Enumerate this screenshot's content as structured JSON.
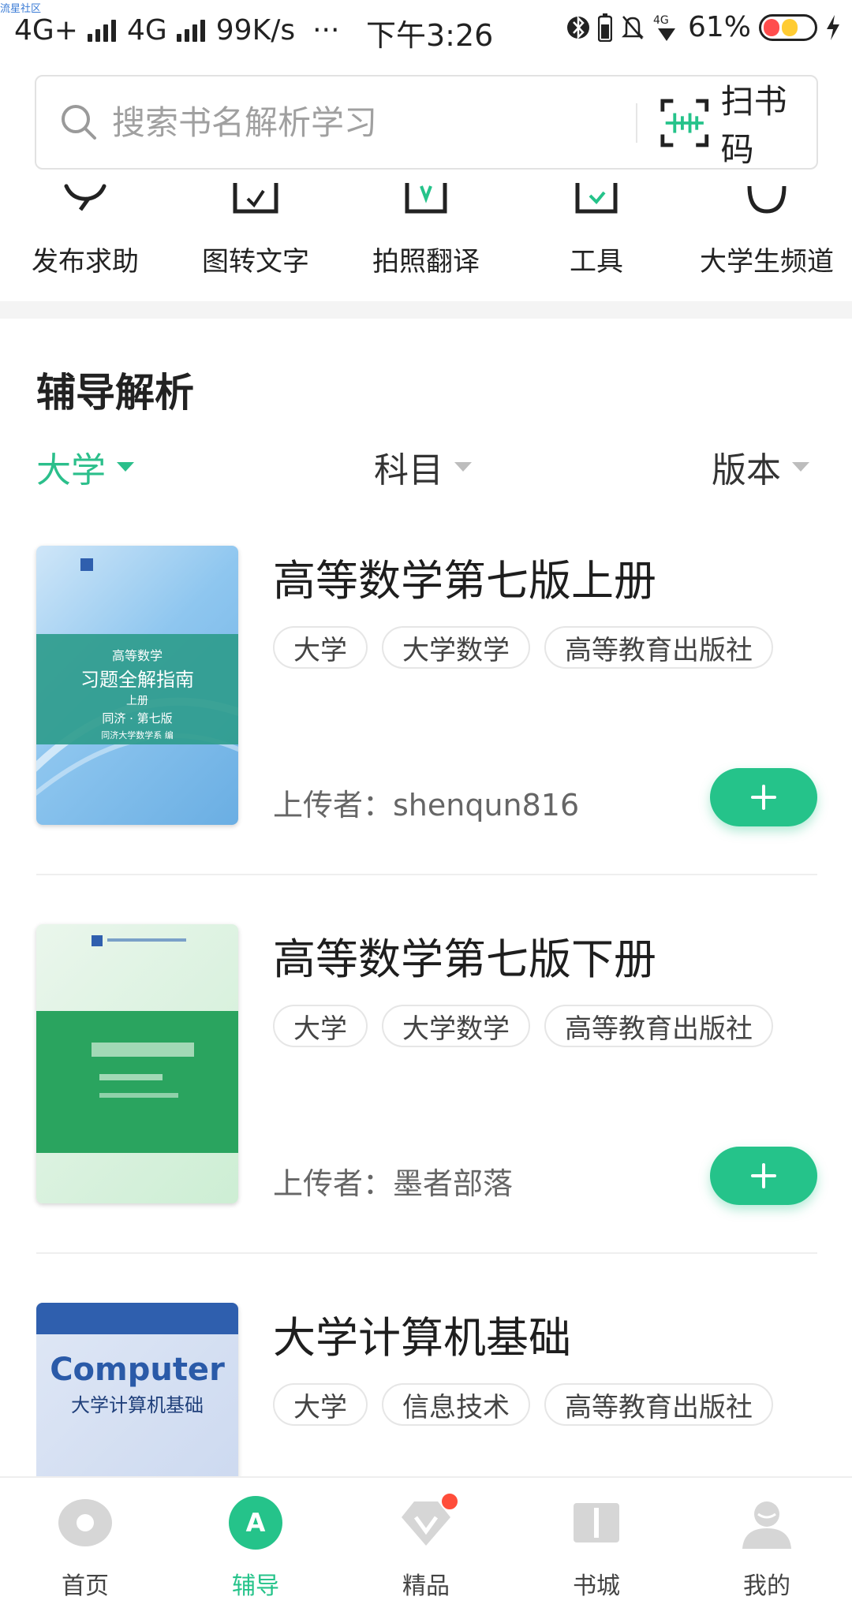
{
  "watermark": "流星社区",
  "status_bar": {
    "network1": "4G+",
    "network2": "4G",
    "speed": "99K/s",
    "more": "···",
    "time": "下午3:26",
    "battery_pct": "61%"
  },
  "search": {
    "placeholder": "搜索书名解析学习",
    "scan_label": "扫书码"
  },
  "quick_actions": [
    {
      "label": "发布求助",
      "icon": "chat-bubble-icon"
    },
    {
      "label": "图转文字",
      "icon": "image-to-text-icon"
    },
    {
      "label": "拍照翻译",
      "icon": "photo-translate-icon"
    },
    {
      "label": "工具",
      "icon": "tools-icon"
    },
    {
      "label": "大学生频道",
      "icon": "student-channel-icon"
    }
  ],
  "section": {
    "title": "辅导解析",
    "filters": [
      {
        "label": "大学",
        "active": true
      },
      {
        "label": "科目",
        "active": false
      },
      {
        "label": "版本",
        "active": false
      }
    ]
  },
  "books": [
    {
      "title": "高等数学第七版上册",
      "tags": [
        "大学",
        "大学数学",
        "高等教育出版社"
      ],
      "uploader": "上传者：shenqun816",
      "cover": {
        "line1": "高等数学",
        "line2": "习题全解指南",
        "line3": "上册",
        "line4": "同济 · 第七版",
        "line5": "同济大学数学系 编"
      }
    },
    {
      "title": "高等数学第七版下册",
      "tags": [
        "大学",
        "大学数学",
        "高等教育出版社"
      ],
      "uploader": "上传者：墨者部落"
    },
    {
      "title": "大学计算机基础",
      "tags": [
        "大学",
        "信息技术",
        "高等教育出版社"
      ],
      "cover": {
        "word": "Computer",
        "cn": "大学计算机基础"
      }
    }
  ],
  "tabbar": [
    {
      "label": "首页",
      "icon": "home-icon",
      "active": false
    },
    {
      "label": "辅导",
      "icon": "tutor-icon",
      "active": true
    },
    {
      "label": "精品",
      "icon": "diamond-icon",
      "active": false,
      "badge": true
    },
    {
      "label": "书城",
      "icon": "book-store-icon",
      "active": false
    },
    {
      "label": "我的",
      "icon": "profile-icon",
      "active": false
    }
  ],
  "colors": {
    "accent": "#25c38a",
    "badge": "#ff4d3a"
  }
}
